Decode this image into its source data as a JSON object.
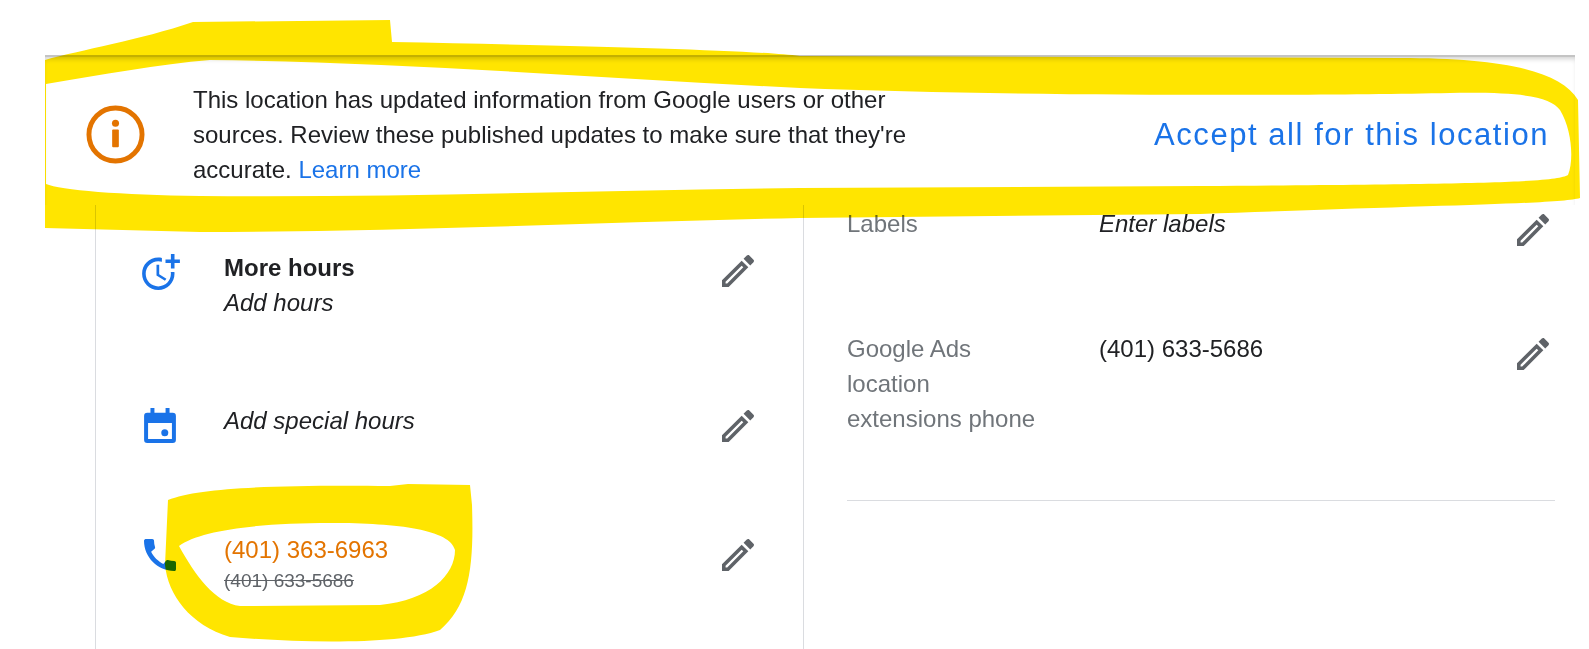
{
  "banner": {
    "highlighted": true,
    "message": "This location has updated information from Google users or other sources. Review these published updates to make sure that they're accurate.",
    "link": "Learn more",
    "action": "Accept all for this location"
  },
  "left_items": [
    {
      "kind": "hours",
      "title": "More hours",
      "hint": "Add hours"
    },
    {
      "kind": "special_hours",
      "hint": "Add special hours"
    },
    {
      "kind": "phone",
      "value": "(401) 363-6963",
      "previous_value": "(401) 633-5686",
      "updated": true,
      "highlighted": true
    }
  ],
  "right_rows": [
    {
      "label": "Labels",
      "hint": "Enter labels"
    },
    {
      "label": "Google Ads location extensions phone",
      "value": "(401) 633-5686"
    }
  ]
}
